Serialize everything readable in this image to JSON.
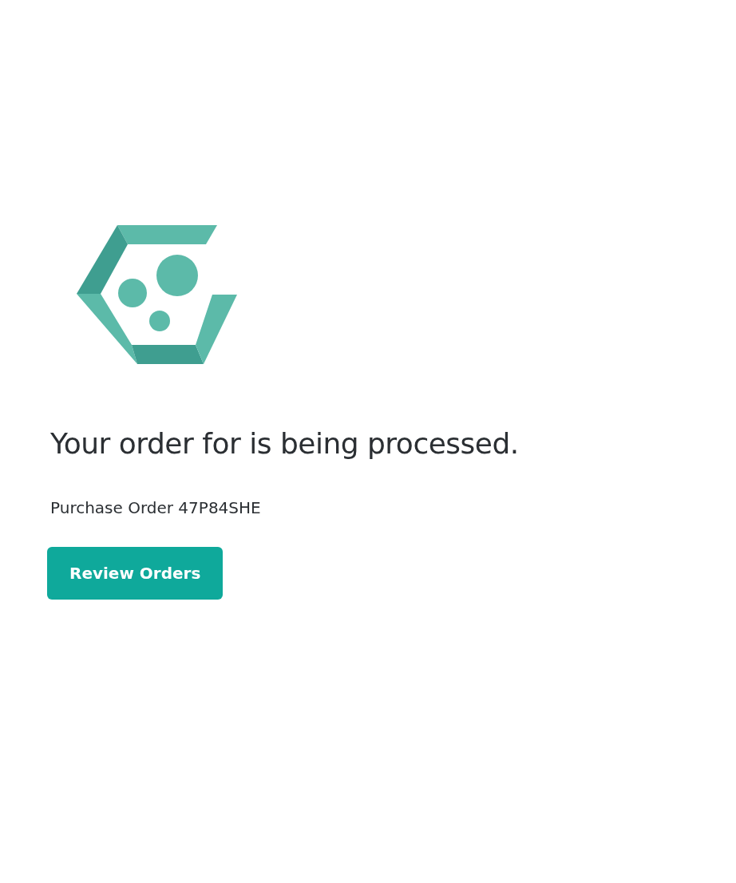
{
  "heading": "Your order for is being processed.",
  "purchase_order": "Purchase Order 47P84SHE",
  "button": {
    "label": "Review Orders"
  }
}
